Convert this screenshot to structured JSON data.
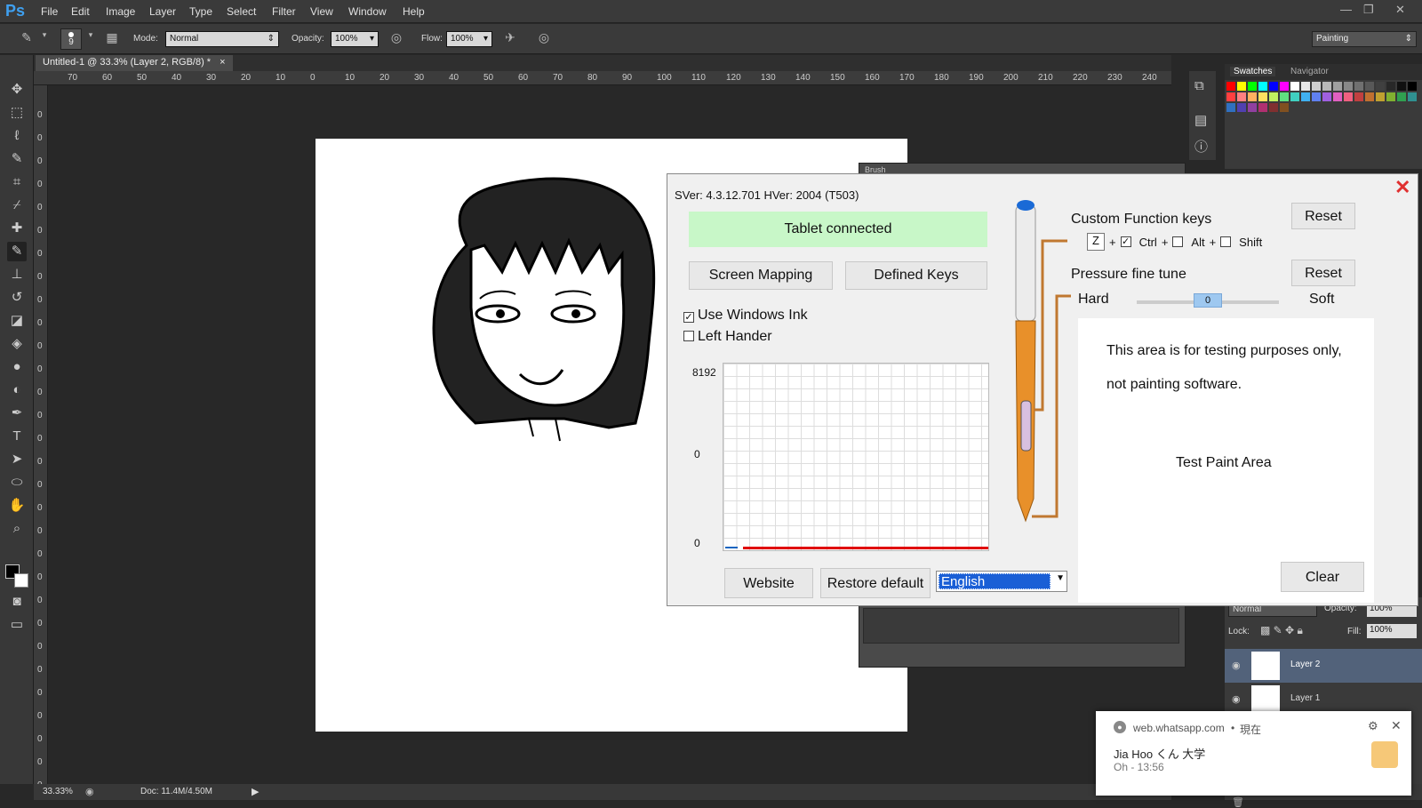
{
  "app": {
    "logo": "Ps",
    "menu": [
      "File",
      "Edit",
      "Image",
      "Layer",
      "Type",
      "Select",
      "Filter",
      "View",
      "Window",
      "Help"
    ]
  },
  "options_bar": {
    "brush_size": "9",
    "mode_label": "Mode:",
    "mode_value": "Normal",
    "opacity_label": "Opacity:",
    "opacity_value": "100%",
    "flow_label": "Flow:",
    "flow_value": "100%",
    "workspace": "Painting"
  },
  "document": {
    "tab_title": "Untitled-1 @ 33.3% (Layer 2, RGB/8) *",
    "zoom": "33.33%",
    "doc_size": "Doc: 11.4M/4.50M"
  },
  "ruler": {
    "top_ticks": [
      "70",
      "60",
      "50",
      "40",
      "30",
      "20",
      "10",
      "0",
      "10",
      "20",
      "30",
      "40",
      "50",
      "60",
      "70",
      "80",
      "90",
      "100",
      "110",
      "120",
      "130",
      "140",
      "150",
      "160",
      "170",
      "180",
      "190",
      "200",
      "210",
      "220",
      "230",
      "240"
    ],
    "left_ticks": [
      "0",
      "0",
      "0",
      "0",
      "0",
      "0",
      "0",
      "0",
      "0",
      "0",
      "0",
      "0",
      "0",
      "0",
      "0",
      "0",
      "0",
      "0",
      "0",
      "0",
      "0",
      "0",
      "0",
      "0",
      "0",
      "0",
      "0",
      "0",
      "0",
      "0"
    ]
  },
  "panels": {
    "swatches_tab": "Swatches",
    "navigator_tab": "Navigator",
    "brush_tab": "Brush",
    "layers": {
      "blend_mode": "Normal",
      "opacity_label": "Opacity:",
      "opacity_value": "100%",
      "lock_label": "Lock:",
      "fill_label": "Fill:",
      "fill_value": "100%",
      "items": [
        "Layer 2",
        "Layer 1"
      ]
    }
  },
  "tablet": {
    "version": "SVer: 4.3.12.701   HVer: 2004   (T503)",
    "status": "Tablet connected",
    "screen_mapping": "Screen Mapping",
    "defined_keys": "Defined Keys",
    "use_windows_ink": "Use Windows Ink",
    "left_hander": "Left Hander",
    "graph_ticks": [
      "8192",
      "0",
      "0"
    ],
    "website": "Website",
    "restore_default": "Restore default",
    "language": "English",
    "custom_function_keys": "Custom Function keys",
    "reset": "Reset",
    "key_value": "Z",
    "ctrl": "Ctrl",
    "alt": "Alt",
    "shift": "Shift",
    "plus": "+",
    "pressure_fine_tune": "Pressure fine tune",
    "hard": "Hard",
    "soft": "Soft",
    "slider_value": "0",
    "slider_level": 0.5,
    "test_text_1": "This area is for testing purposes only,",
    "test_text_2": "not painting software.",
    "test_paint_area": "Test Paint Area",
    "clear": "Clear",
    "close": "✕"
  },
  "notification": {
    "source": "web.whatsapp.com",
    "time_sep": "•",
    "time": "現在",
    "title": "Jia Hoo くん 大学",
    "message": "Oh - 13:56"
  },
  "colors": {
    "accent_blue": "#3fa0f0",
    "status_green": "#c8f7c8",
    "graph_red": "#e00000",
    "pen_orange": "#e8902a",
    "dialog_close": "#e03030"
  },
  "swatch_colors": [
    "#ff0000",
    "#ffff00",
    "#00ff00",
    "#00ffff",
    "#0000ff",
    "#ff00ff",
    "#ffffff",
    "#e8e8e8",
    "#d0d0d0",
    "#b8b8b8",
    "#a0a0a0",
    "#888888",
    "#707070",
    "#585858",
    "#404040",
    "#282828",
    "#101010",
    "#000000",
    "#ff4040",
    "#ff8080",
    "#ffb060",
    "#ffe060",
    "#c0f060",
    "#60e080",
    "#40d0c0",
    "#40b0f0",
    "#6080f0",
    "#a060e0",
    "#e060c0",
    "#f06080",
    "#c04040",
    "#c07030",
    "#c0a030",
    "#80b030",
    "#30a050",
    "#309090",
    "#3070c0",
    "#5040b0",
    "#9040a0",
    "#b03070",
    "#803030",
    "#805020"
  ]
}
